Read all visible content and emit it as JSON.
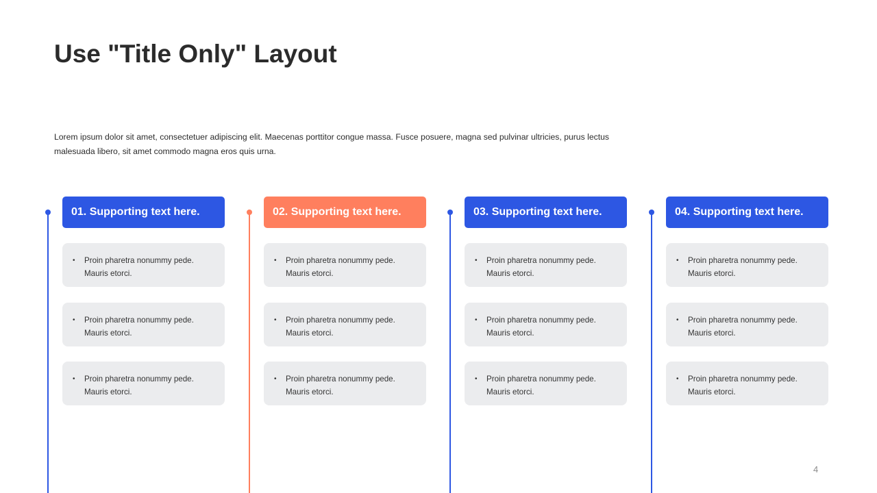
{
  "slide": {
    "title": "Use \"Title Only\" Layout",
    "intro": "Lorem ipsum dolor sit amet, consectetuer adipiscing elit. Maecenas porttitor congue massa. Fusce posuere, magna sed pulvinar ultricies, purus lectus malesuada libero, sit amet commodo magna eros quis urna.",
    "page_number": "4",
    "colors": {
      "blue": "#2d57e3",
      "orange": "#ff7f5e",
      "card_bg": "#ebecee"
    },
    "columns": [
      {
        "heading": "01. Supporting text here.",
        "accent": "blue",
        "items": [
          "Proin pharetra nonummy pede. Mauris etorci.",
          "Proin pharetra nonummy pede. Mauris etorci.",
          "Proin pharetra nonummy pede. Mauris etorci."
        ]
      },
      {
        "heading": "02. Supporting text here.",
        "accent": "orange",
        "items": [
          "Proin pharetra nonummy pede. Mauris etorci.",
          "Proin pharetra nonummy pede. Mauris etorci.",
          "Proin pharetra nonummy pede. Mauris etorci."
        ]
      },
      {
        "heading": "03. Supporting text here.",
        "accent": "blue",
        "items": [
          "Proin pharetra nonummy pede. Mauris etorci.",
          "Proin pharetra nonummy pede. Mauris etorci.",
          "Proin pharetra nonummy pede. Mauris etorci."
        ]
      },
      {
        "heading": "04. Supporting text here.",
        "accent": "blue",
        "items": [
          "Proin pharetra nonummy pede. Mauris etorci.",
          "Proin pharetra nonummy pede. Mauris etorci.",
          "Proin pharetra nonummy pede. Mauris etorci."
        ]
      }
    ]
  }
}
